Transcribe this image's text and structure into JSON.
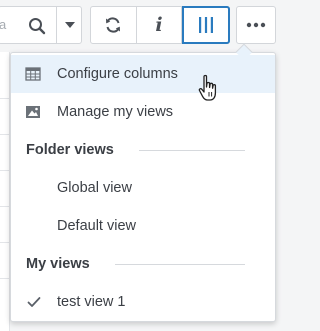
{
  "toolbar": {
    "search": {
      "placeholder_fragment": "a"
    },
    "buttons": {
      "refresh": "refresh-icon",
      "info": "i",
      "columns": "columns-icon",
      "more": "more-icon"
    },
    "accent_color": "#2a7bbf"
  },
  "menu": {
    "items": [
      {
        "label": "Configure columns",
        "icon": "table-grid-icon",
        "highlighted": true
      },
      {
        "label": "Manage my views",
        "icon": "image-view-icon",
        "highlighted": false
      }
    ],
    "sections": [
      {
        "title": "Folder views",
        "items": [
          {
            "label": "Global view",
            "checked": false
          },
          {
            "label": "Default view",
            "checked": false
          }
        ]
      },
      {
        "title": "My views",
        "items": [
          {
            "label": "test view 1",
            "checked": true
          }
        ]
      }
    ],
    "highlight_color": "#e8f2fb"
  }
}
